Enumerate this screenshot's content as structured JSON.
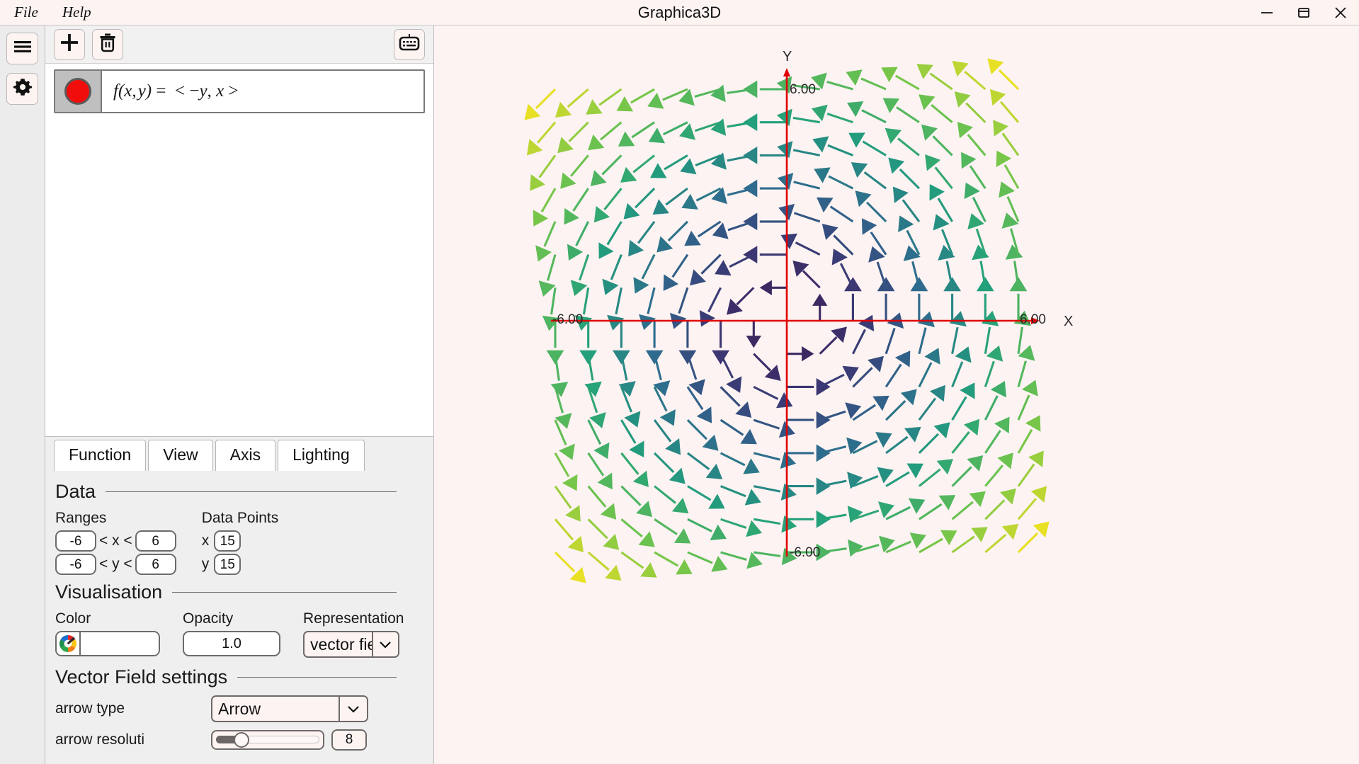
{
  "window": {
    "title": "Graphica3D",
    "menus": [
      {
        "label": "File",
        "name": "menu-file"
      },
      {
        "label": "Help",
        "name": "menu-help"
      }
    ],
    "controls": {
      "minimize": "minimize-icon",
      "maximize": "maximize-icon",
      "close": "close-icon"
    }
  },
  "rail": {
    "items": [
      {
        "icon": "hamburger-menu-icon",
        "name": "sidebar-menu-button"
      },
      {
        "icon": "gear-icon",
        "name": "sidebar-settings-button"
      }
    ]
  },
  "function_toolbar": {
    "add_label": "+",
    "add_icon": "plus-icon",
    "delete_icon": "trash-icon",
    "keyboard_icon": "keyboard-icon"
  },
  "functions": [
    {
      "color": "#f20d0d",
      "expression": "f(x, y) =  < −y, x >",
      "expr_parts": {
        "f": "f",
        "args": "(x, y)",
        "equals": "=",
        "value": "< −y, x >"
      }
    }
  ],
  "tabs": [
    {
      "label": "Function",
      "active": true
    },
    {
      "label": "View",
      "active": false
    },
    {
      "label": "Axis",
      "active": false
    },
    {
      "label": "Lighting",
      "active": false
    }
  ],
  "panel": {
    "data_section": {
      "title": "Data",
      "ranges_label": "Ranges",
      "data_points_label": "Data Points",
      "x_min": "-6",
      "x_max": "6",
      "y_min": "-6",
      "y_max": "6",
      "x_cmp_left": "< x <",
      "y_cmp_left": "< y <",
      "x_points_label": "x",
      "x_points": "15",
      "y_points_label": "y",
      "y_points": "15"
    },
    "visualisation_section": {
      "title": "Visualisation",
      "color_label": "Color",
      "color_value": "#ffffff",
      "color_wheel_icon": "color-wheel-icon",
      "opacity_label": "Opacity",
      "opacity_value": "1.0",
      "representation_label": "Representation",
      "representation_value": "vector fie",
      "representation_full": "vector field",
      "chevron_icon": "chevron-down-icon"
    },
    "vector_field_section": {
      "title": "Vector Field settings",
      "arrow_type_label": "arrow type",
      "arrow_type_value": "Arrow",
      "arrow_resolution_label": "arrow resoluti",
      "arrow_resolution_value": "8"
    }
  },
  "chart_data": {
    "type": "vector-field",
    "title": "",
    "function": "f(x, y) = <-y, x>",
    "xlabel": "X",
    "ylabel": "Y",
    "xlim": [
      -6,
      6
    ],
    "ylim": [
      -6,
      6
    ],
    "grid_points_x": 15,
    "grid_points_y": 15,
    "x_tick_labels": [
      "-6.00",
      "6.00"
    ],
    "y_tick_labels": [
      "-6.00",
      "6.00"
    ],
    "axis_color": "#e00000",
    "background": "#fdf3f2",
    "colormap": "viridis",
    "colormap_meaning": "magnitude = sqrt(x^2+y^2), dark purple near origin to yellow at outer radius",
    "colormap_stops": [
      {
        "t": 0.0,
        "color": "#3b1c52"
      },
      {
        "t": 0.2,
        "color": "#3c3572"
      },
      {
        "t": 0.4,
        "color": "#2f6a8e"
      },
      {
        "t": 0.6,
        "color": "#219f7c"
      },
      {
        "t": 0.8,
        "color": "#6fc44c"
      },
      {
        "t": 1.0,
        "color": "#e8e024"
      }
    ],
    "arrow_type": "Arrow",
    "arrow_resolution": 8,
    "opacity": 1.0,
    "description": "Rotational (curl) vector field; arrows circulate counterclockwise around the origin with magnitude proportional to distance from origin."
  }
}
